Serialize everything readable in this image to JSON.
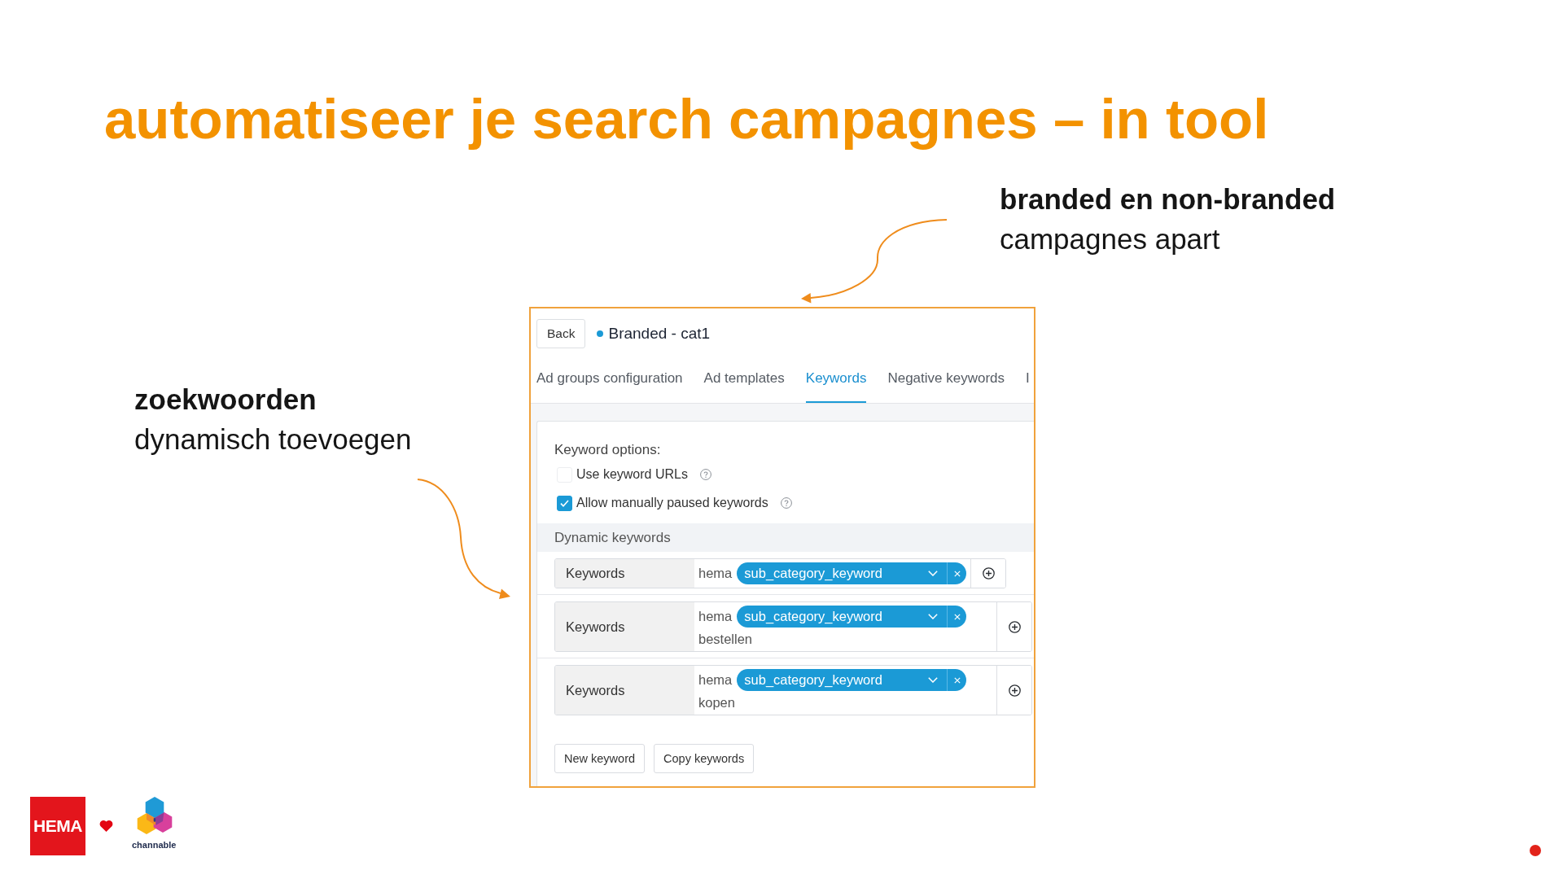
{
  "slide": {
    "title": "automatiseer je search campagnes – in tool"
  },
  "callouts": [
    {
      "heading": "branded en non-branded",
      "text": "campagnes apart"
    },
    {
      "heading": "zoekwoorden",
      "text": "dynamisch toevoegen"
    }
  ],
  "screenshot": {
    "back_button": "Back",
    "campaign": "Branded - cat1",
    "tabs": [
      {
        "label": "Ad groups configuration",
        "selected": false
      },
      {
        "label": "Ad templates",
        "selected": false
      },
      {
        "label": "Keywords",
        "selected": true
      },
      {
        "label": "Negative keywords",
        "selected": false
      },
      {
        "label": "I",
        "selected": false
      }
    ],
    "keyword_options": {
      "title": "Keyword options:",
      "options": [
        {
          "label": "Use keyword URLs",
          "checked": false
        },
        {
          "label": "Allow manually paused keywords",
          "checked": true
        }
      ]
    },
    "dynamic_keywords": {
      "title": "Dynamic keywords",
      "rows": [
        {
          "label": "Keywords",
          "prefix": "hema",
          "token": "sub_category_keyword"
        },
        {
          "label": "Keywords",
          "prefix": "hema",
          "token": "sub_category_keyword",
          "suffix": "bestellen"
        },
        {
          "label": "Keywords",
          "prefix": "hema",
          "token": "sub_category_keyword",
          "suffix": "kopen"
        }
      ]
    },
    "buttons": [
      "New keyword",
      "Copy keywords"
    ]
  },
  "footer": {
    "brand_logo": "HEMA",
    "partner_logo": "channable"
  }
}
